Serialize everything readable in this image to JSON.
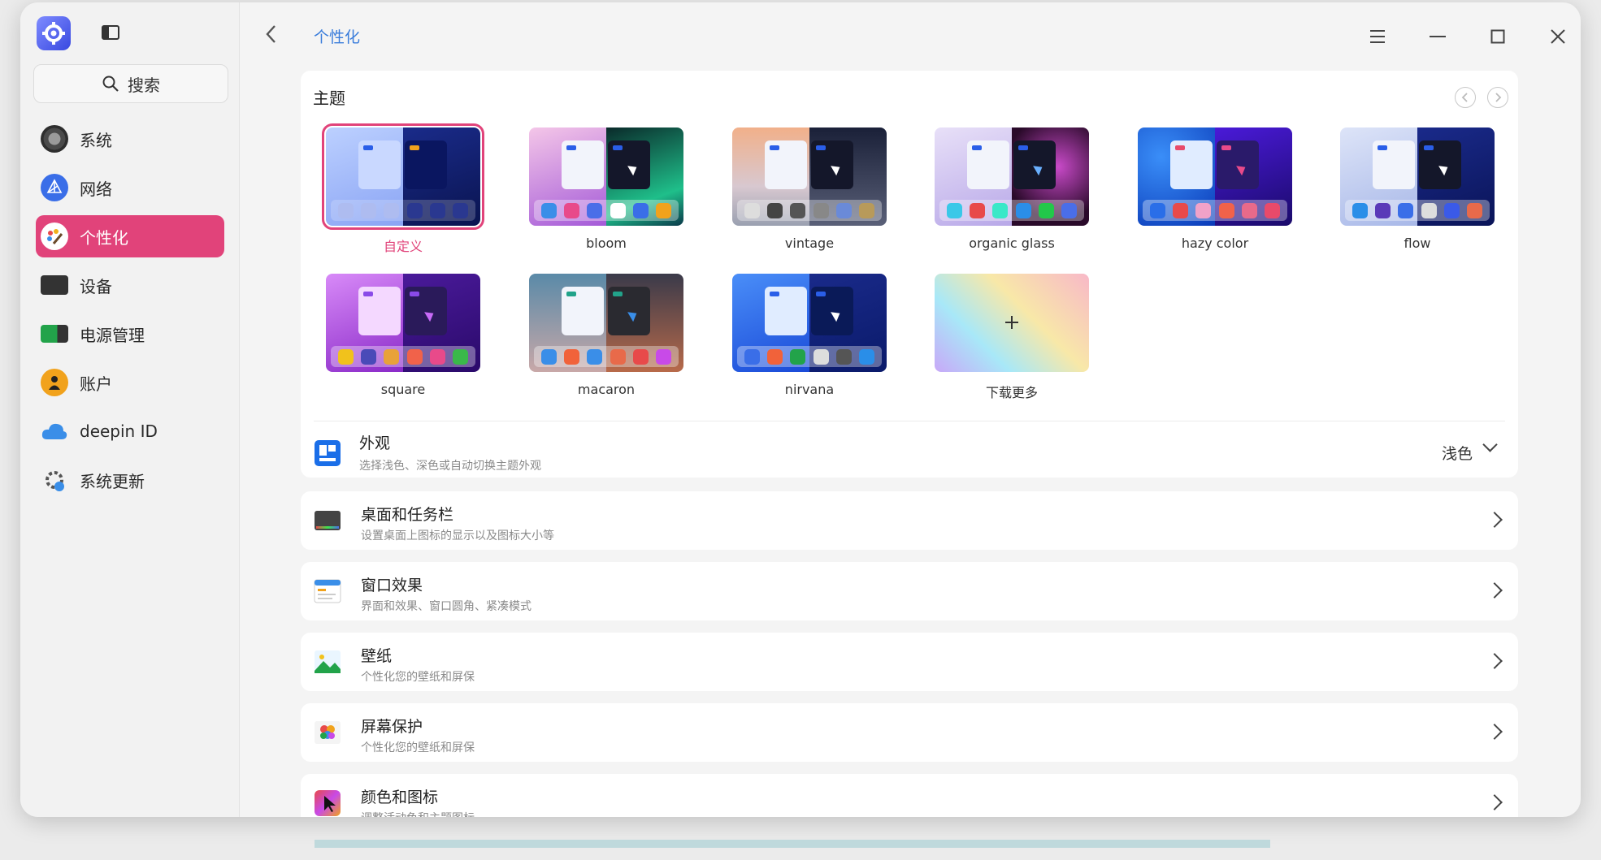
{
  "sidebar": {
    "search_label": "搜索",
    "items": [
      {
        "label": "系统",
        "icon": "system-icon",
        "color": "#444444"
      },
      {
        "label": "网络",
        "icon": "network-icon",
        "color": "#3a6ee8"
      },
      {
        "label": "个性化",
        "icon": "personalization-icon",
        "color": "#e1437a",
        "active": true
      },
      {
        "label": "设备",
        "icon": "device-icon",
        "color": "#444444"
      },
      {
        "label": "电源管理",
        "icon": "power-icon",
        "color": "#22a34a"
      },
      {
        "label": "账户",
        "icon": "account-icon",
        "color": "#f1a21c"
      },
      {
        "label": "deepin ID",
        "icon": "cloud-icon",
        "color": "#3a8ee8"
      },
      {
        "label": "系统更新",
        "icon": "update-icon",
        "color": "#555555"
      }
    ]
  },
  "header": {
    "breadcrumb": "个性化"
  },
  "theme_section": {
    "title": "主题",
    "themes": [
      {
        "label": "自定义",
        "selected": true
      },
      {
        "label": "bloom"
      },
      {
        "label": "vintage"
      },
      {
        "label": "organic glass"
      },
      {
        "label": "hazy color"
      },
      {
        "label": "flow"
      },
      {
        "label": "square"
      },
      {
        "label": "macaron"
      },
      {
        "label": "nirvana"
      },
      {
        "label": "下载更多",
        "add": true
      }
    ]
  },
  "appearance": {
    "title": "外观",
    "subtitle": "选择浅色、深色或自动切换主题外观",
    "value": "浅色"
  },
  "settings": [
    {
      "title": "桌面和任务栏",
      "subtitle": "设置桌面上图标的显示以及图标大小等",
      "icon": "taskbar-icon"
    },
    {
      "title": "窗口效果",
      "subtitle": "界面和效果、窗口圆角、紧凑模式",
      "icon": "window-effect-icon"
    },
    {
      "title": "壁纸",
      "subtitle": "个性化您的壁纸和屏保",
      "icon": "wallpaper-icon"
    },
    {
      "title": "屏幕保护",
      "subtitle": "个性化您的壁纸和屏保",
      "icon": "screensaver-icon"
    },
    {
      "title": "颜色和图标",
      "subtitle": "调整活动色和主题图标",
      "icon": "color-icon"
    }
  ],
  "colors": {
    "accent": "#e1437a",
    "link": "#3a7ddb"
  }
}
